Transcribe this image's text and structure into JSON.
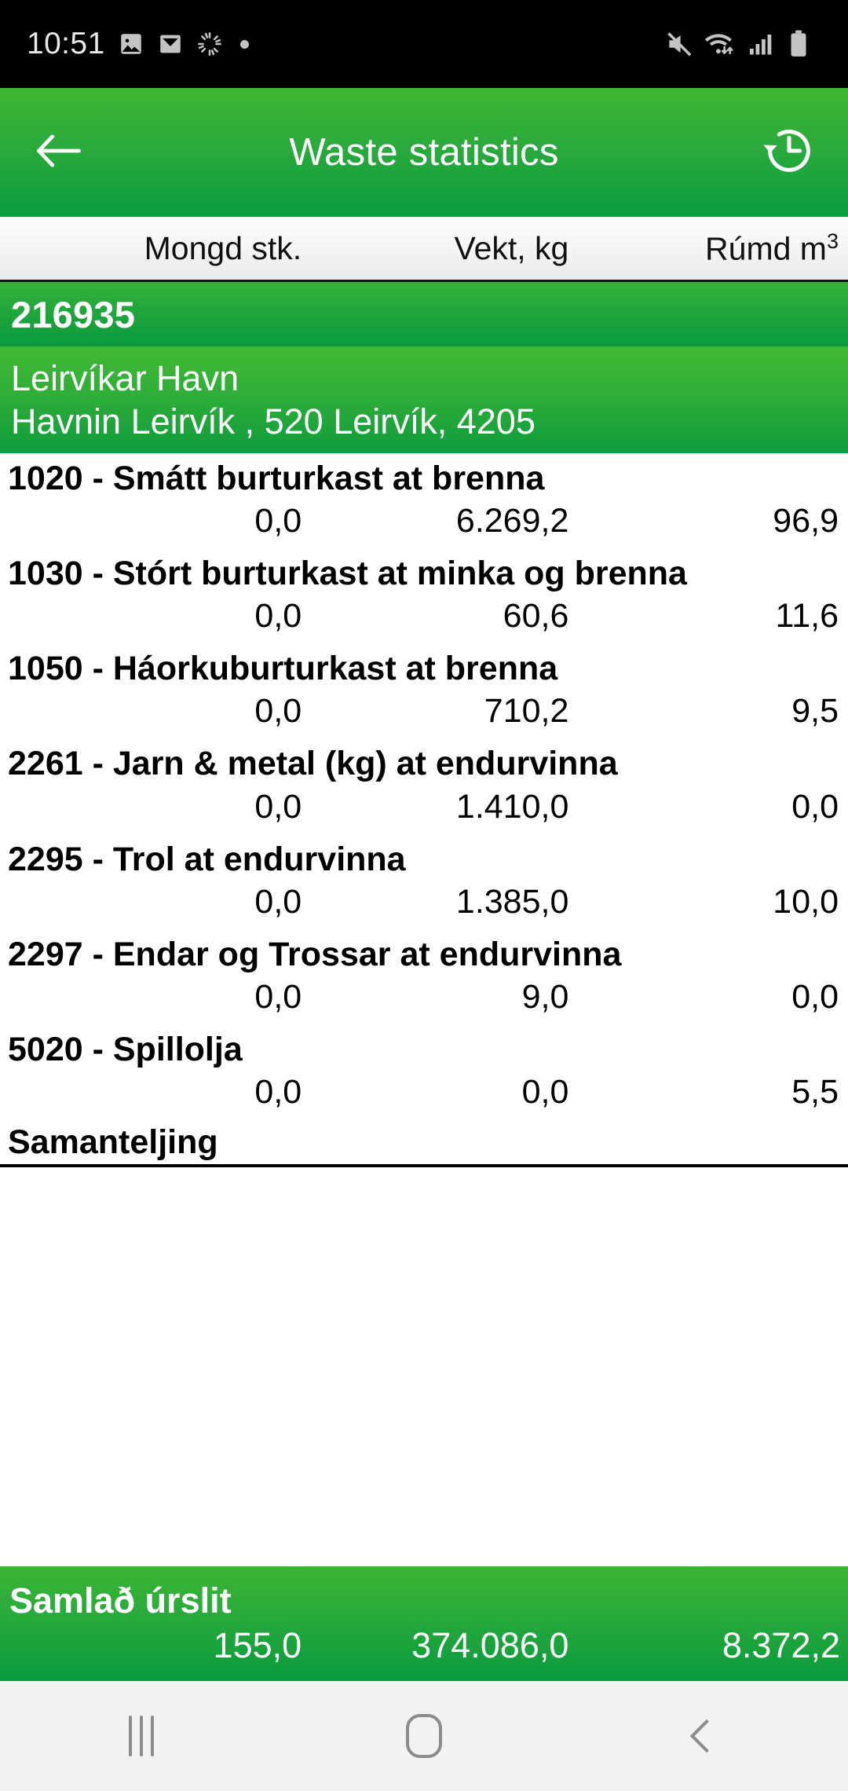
{
  "statusbar": {
    "clock": "10:51",
    "icons_left": [
      "image-icon",
      "email-icon",
      "loading-spinner-icon",
      "dot-icon"
    ],
    "icons_right": [
      "mute-icon",
      "wifi-icon",
      "signal-icon",
      "battery-icon"
    ]
  },
  "appbar": {
    "back_icon": "back-arrow-icon",
    "title": "Waste statistics",
    "action_icon": "history-restore-icon"
  },
  "columns": {
    "c1": "Mongd stk.",
    "c2": "Vekt, kg",
    "c3_base": "Rúmd m",
    "c3_sup": "3"
  },
  "record": {
    "id": "216935",
    "name": "Leirvíkar Havn",
    "address": "Havnin Leirvík , 520 Leirvík, 4205"
  },
  "rows": [
    {
      "label": "1020 - Smátt burturkast at brenna",
      "c1": "0,0",
      "c2": "6.269,2",
      "c3": "96,9"
    },
    {
      "label": "1030 - Stórt burturkast at minka og brenna",
      "c1": "0,0",
      "c2": "60,6",
      "c3": "11,6"
    },
    {
      "label": "1050 - Háorkuburturkast at brenna",
      "c1": "0,0",
      "c2": "710,2",
      "c3": "9,5"
    },
    {
      "label": "2261 - Jarn & metal (kg)  at endurvinna",
      "c1": "0,0",
      "c2": "1.410,0",
      "c3": "0,0"
    },
    {
      "label": "2295 - Trol at endurvinna",
      "c1": "0,0",
      "c2": "1.385,0",
      "c3": "10,0"
    },
    {
      "label": "2297 - Endar og Trossar at endurvinna",
      "c1": "0,0",
      "c2": "9,0",
      "c3": "0,0"
    },
    {
      "label": "5020 - Spillolja",
      "c1": "0,0",
      "c2": "0,0",
      "c3": "5,5"
    }
  ],
  "subtotal_label": "Samanteljing",
  "total": {
    "label": "Samlað úrslit",
    "c1": "155,0",
    "c2": "374.086,0",
    "c3": "8.372,2"
  },
  "navbar": {
    "recents_icon": "recents-icon",
    "home_icon": "home-icon",
    "back_icon": "nav-back-icon"
  },
  "colors": {
    "brand_green": "#2bab3c",
    "brand_green_light": "#43b933",
    "brand_green_dark": "#0a9a3e"
  }
}
